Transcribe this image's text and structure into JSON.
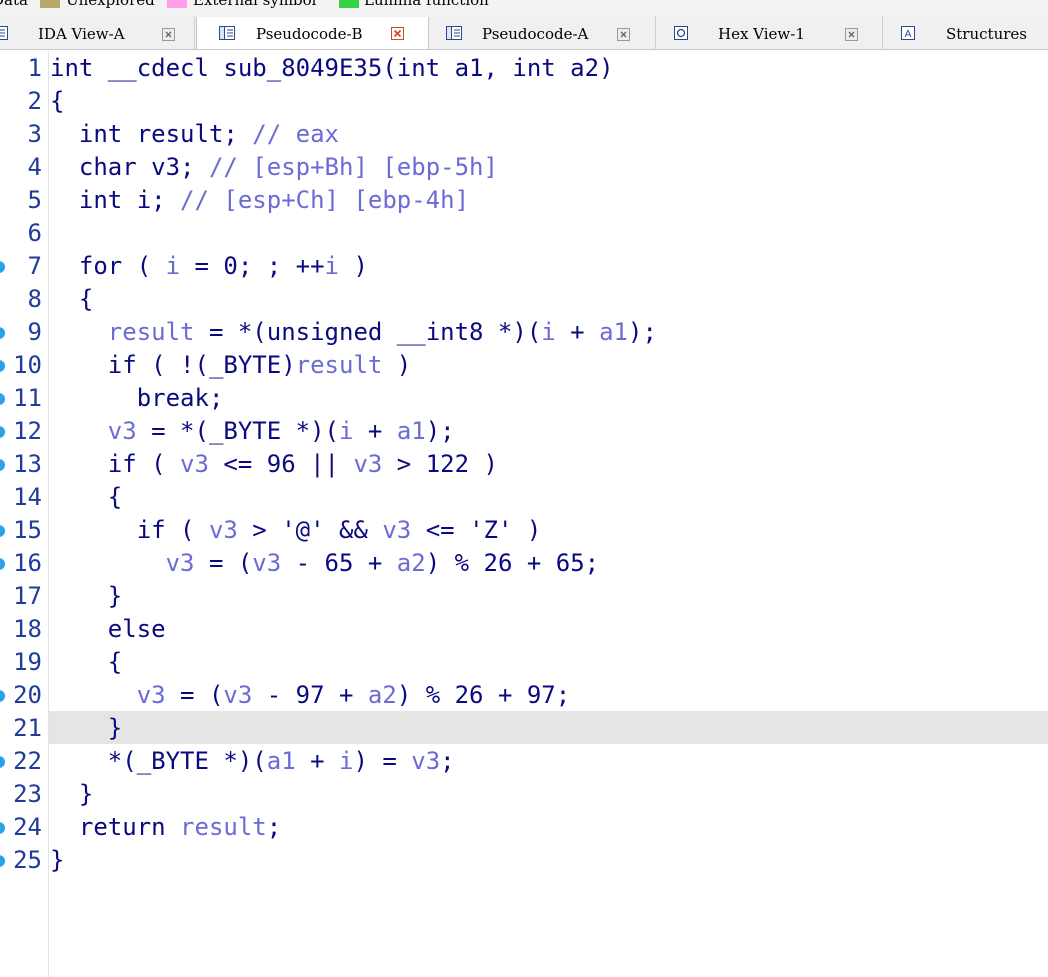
{
  "legend": {
    "items": [
      {
        "label": "Data",
        "color": ""
      },
      {
        "label": "Unexplored",
        "color": "#b5aa6b"
      },
      {
        "label": "External symbol",
        "color": "#ff9ee6"
      },
      {
        "label": "Lumina function",
        "color": "#36d34a"
      }
    ]
  },
  "tabs": [
    {
      "label": "IDA View-A",
      "icon": "disassembly-icon",
      "active": false
    },
    {
      "label": "Pseudocode-B",
      "icon": "pseudocode-icon",
      "active": true
    },
    {
      "label": "Pseudocode-A",
      "icon": "pseudocode-icon",
      "active": false
    },
    {
      "label": "Hex View-1",
      "icon": "hex-view-icon",
      "active": false
    },
    {
      "label": "Structures",
      "icon": "structures-icon",
      "active": false
    }
  ],
  "code": {
    "current_line": 21,
    "lines": [
      {
        "n": "1",
        "bp": false,
        "tokens": [
          [
            "pl",
            "int __cdecl sub_8049E35(int a1, int a2)"
          ]
        ]
      },
      {
        "n": "2",
        "bp": false,
        "tokens": [
          [
            "pl",
            "{"
          ]
        ]
      },
      {
        "n": "3",
        "bp": false,
        "tokens": [
          [
            "pl",
            "  int result; "
          ],
          [
            "cm",
            "// eax"
          ]
        ]
      },
      {
        "n": "4",
        "bp": false,
        "tokens": [
          [
            "pl",
            "  char v3; "
          ],
          [
            "cm",
            "// [esp+Bh] [ebp-5h]"
          ]
        ]
      },
      {
        "n": "5",
        "bp": false,
        "tokens": [
          [
            "pl",
            "  int i; "
          ],
          [
            "cm",
            "// [esp+Ch] [ebp-4h]"
          ]
        ]
      },
      {
        "n": "6",
        "bp": false,
        "tokens": [
          [
            "pl",
            ""
          ]
        ]
      },
      {
        "n": "7",
        "bp": true,
        "tokens": [
          [
            "pl",
            "  for ( "
          ],
          [
            "va",
            "i"
          ],
          [
            "pl",
            " = 0; ; ++"
          ],
          [
            "va",
            "i"
          ],
          [
            "pl",
            " )"
          ]
        ]
      },
      {
        "n": "8",
        "bp": false,
        "tokens": [
          [
            "pl",
            "  {"
          ]
        ]
      },
      {
        "n": "9",
        "bp": true,
        "tokens": [
          [
            "pl",
            "    "
          ],
          [
            "va",
            "result"
          ],
          [
            "pl",
            " = *(unsigned __int8 *)("
          ],
          [
            "va",
            "i"
          ],
          [
            "pl",
            " + "
          ],
          [
            "va",
            "a1"
          ],
          [
            "pl",
            ");"
          ]
        ]
      },
      {
        "n": "10",
        "bp": true,
        "tokens": [
          [
            "pl",
            "    if ( !(_BYTE)"
          ],
          [
            "va",
            "result"
          ],
          [
            "pl",
            " )"
          ]
        ]
      },
      {
        "n": "11",
        "bp": true,
        "tokens": [
          [
            "pl",
            "      break;"
          ]
        ]
      },
      {
        "n": "12",
        "bp": true,
        "tokens": [
          [
            "pl",
            "    "
          ],
          [
            "va",
            "v3"
          ],
          [
            "pl",
            " = *(_BYTE *)("
          ],
          [
            "va",
            "i"
          ],
          [
            "pl",
            " + "
          ],
          [
            "va",
            "a1"
          ],
          [
            "pl",
            ");"
          ]
        ]
      },
      {
        "n": "13",
        "bp": true,
        "tokens": [
          [
            "pl",
            "    if ( "
          ],
          [
            "va",
            "v3"
          ],
          [
            "pl",
            " <= 96 || "
          ],
          [
            "va",
            "v3"
          ],
          [
            "pl",
            " > 122 )"
          ]
        ]
      },
      {
        "n": "14",
        "bp": false,
        "tokens": [
          [
            "pl",
            "    {"
          ]
        ]
      },
      {
        "n": "15",
        "bp": true,
        "tokens": [
          [
            "pl",
            "      if ( "
          ],
          [
            "va",
            "v3"
          ],
          [
            "pl",
            " > '@' && "
          ],
          [
            "va",
            "v3"
          ],
          [
            "pl",
            " <= 'Z' )"
          ]
        ]
      },
      {
        "n": "16",
        "bp": true,
        "tokens": [
          [
            "pl",
            "        "
          ],
          [
            "va",
            "v3"
          ],
          [
            "pl",
            " = ("
          ],
          [
            "va",
            "v3"
          ],
          [
            "pl",
            " - 65 + "
          ],
          [
            "va",
            "a2"
          ],
          [
            "pl",
            ") % 26 + 65;"
          ]
        ]
      },
      {
        "n": "17",
        "bp": false,
        "tokens": [
          [
            "pl",
            "    }"
          ]
        ]
      },
      {
        "n": "18",
        "bp": false,
        "tokens": [
          [
            "pl",
            "    else"
          ]
        ]
      },
      {
        "n": "19",
        "bp": false,
        "tokens": [
          [
            "pl",
            "    {"
          ]
        ]
      },
      {
        "n": "20",
        "bp": true,
        "tokens": [
          [
            "pl",
            "      "
          ],
          [
            "va",
            "v3"
          ],
          [
            "pl",
            " = ("
          ],
          [
            "va",
            "v3"
          ],
          [
            "pl",
            " - 97 + "
          ],
          [
            "va",
            "a2"
          ],
          [
            "pl",
            ") % 26 + 97;"
          ]
        ]
      },
      {
        "n": "21",
        "bp": false,
        "tokens": [
          [
            "pl",
            "    }"
          ]
        ]
      },
      {
        "n": "22",
        "bp": true,
        "tokens": [
          [
            "pl",
            "    *(_BYTE *)("
          ],
          [
            "va",
            "a1"
          ],
          [
            "pl",
            " + "
          ],
          [
            "va",
            "i"
          ],
          [
            "pl",
            ") = "
          ],
          [
            "va",
            "v3"
          ],
          [
            "pl",
            ";"
          ]
        ]
      },
      {
        "n": "23",
        "bp": false,
        "tokens": [
          [
            "pl",
            "  }"
          ]
        ]
      },
      {
        "n": "24",
        "bp": true,
        "tokens": [
          [
            "pl",
            "  return "
          ],
          [
            "va",
            "result"
          ],
          [
            "pl",
            ";"
          ]
        ]
      },
      {
        "n": "25",
        "bp": true,
        "tokens": [
          [
            "pl",
            "}"
          ]
        ]
      }
    ]
  }
}
